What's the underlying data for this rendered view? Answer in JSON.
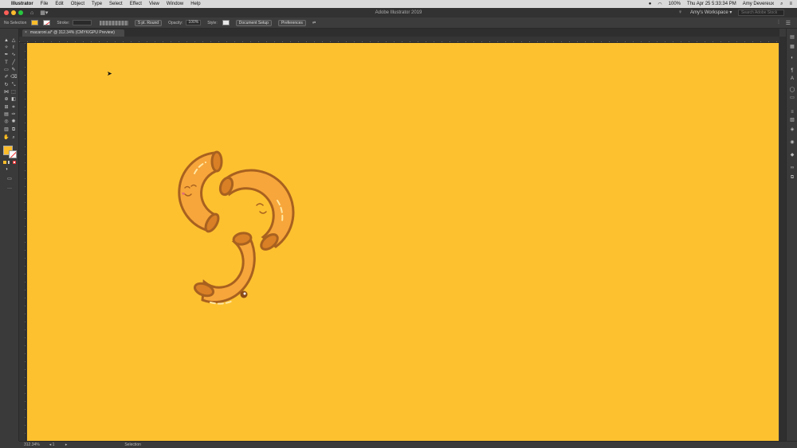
{
  "menubar": {
    "app_name": "Illustrator",
    "items": [
      "File",
      "Edit",
      "Object",
      "Type",
      "Select",
      "Effect",
      "View",
      "Window",
      "Help"
    ],
    "battery": "100%",
    "datetime": "Thu Apr 25  5:33:34 PM",
    "user": "Amy Devereux"
  },
  "titlebar": {
    "title": "Adobe Illustrator 2019",
    "workspace": "Amy's Workspace",
    "search_placeholder": "Search Adobe Stock"
  },
  "controlbar": {
    "selection_status": "No Selection",
    "stroke_label": "Stroke:",
    "brush_profile": "5 pt. Round",
    "opacity_label": "Opacity:",
    "opacity_value": "100%",
    "style_label": "Style:",
    "document_setup": "Document Setup",
    "preferences": "Preferences"
  },
  "document_tab": {
    "name": "macaroni.ai* @ 312.34% (CMYK/GPU Preview)"
  },
  "statusbar": {
    "zoom": "312.34%",
    "artboard": "1",
    "tool": "Selection"
  },
  "colors": {
    "canvas": "#fdc130",
    "macaroni_fill": "#f7a63b",
    "macaroni_outline": "#a8611f",
    "fill_swatch": "#fdbd2a"
  }
}
